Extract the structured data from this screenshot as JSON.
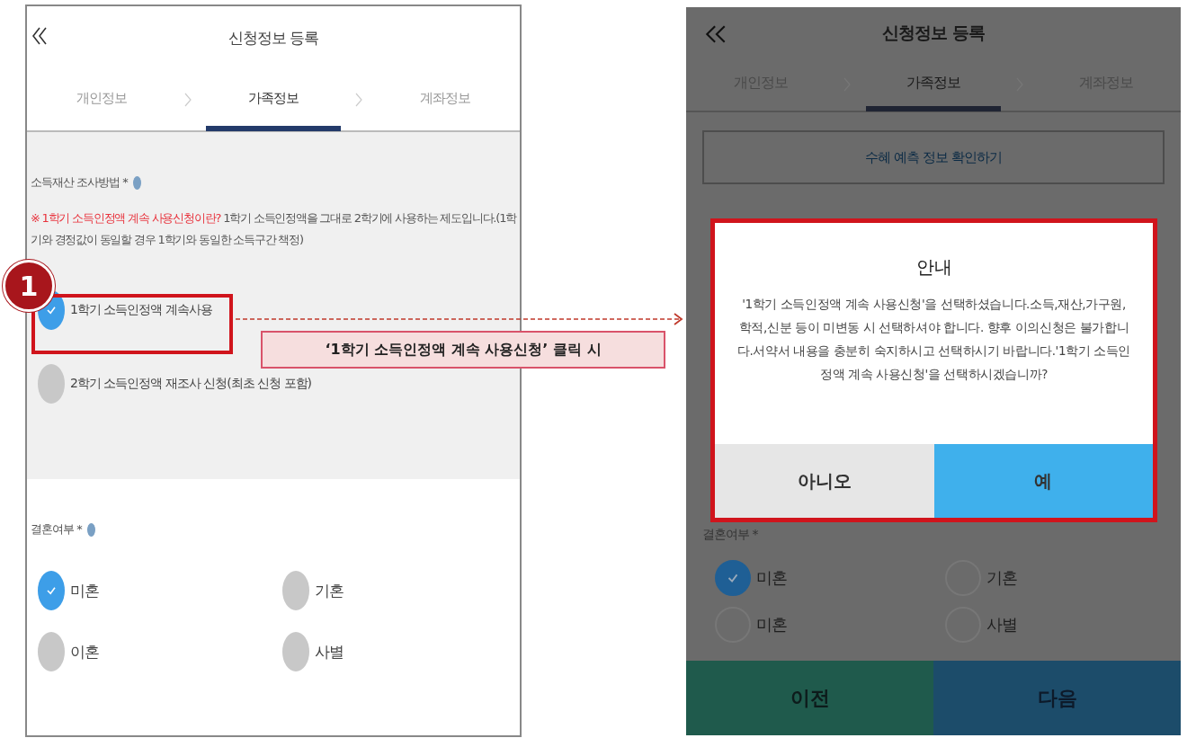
{
  "left_screen": {
    "title": "신청정보 등록",
    "tabs": [
      {
        "label": "개인정보",
        "selected": false
      },
      {
        "label": "가족정보",
        "selected": true
      },
      {
        "label": "계좌정보",
        "selected": false
      }
    ],
    "income_section": {
      "label": "소득재산 조사방법 *",
      "notice_highlight": "※ 1학기 소득인정액 계속 사용신청이란?",
      "notice_text": "1학기 소득인정액을 그대로 2학기에 사용하는 제도입니다.(1학기와 경정값이 동일할 경우 1학기와 동일한 소득구간 책정)",
      "options": [
        {
          "label": "1학기 소득인정액 계속사용",
          "checked": true
        },
        {
          "label": "2학기 소득인정액 재조사 신청(최초 신청 포함)",
          "checked": false
        }
      ]
    },
    "marital_section": {
      "label": "결혼여부 *",
      "options": [
        {
          "label": "미혼",
          "checked": true
        },
        {
          "label": "기혼",
          "checked": false
        },
        {
          "label": "이혼",
          "checked": false
        },
        {
          "label": "사별",
          "checked": false
        }
      ]
    }
  },
  "annotation": {
    "step": "1",
    "callout": "‘1학기 소득인정액 계속 사용신청’ 클릭 시"
  },
  "right_screen": {
    "title": "신청정보 등록",
    "tabs": [
      {
        "label": "개인정보",
        "selected": false
      },
      {
        "label": "가족정보",
        "selected": true
      },
      {
        "label": "계좌정보",
        "selected": false
      }
    ],
    "info_button": "수혜 예측 정보 확인하기",
    "marital_section": {
      "label": "결혼여부 *",
      "options": [
        {
          "label": "미혼",
          "checked": true
        },
        {
          "label": "기혼",
          "checked": false
        },
        {
          "label": "미혼",
          "checked": false
        },
        {
          "label": "사별",
          "checked": false
        }
      ]
    },
    "buttons": [
      {
        "label": "이전",
        "kind": "prev"
      },
      {
        "label": "다음",
        "kind": "next"
      }
    ],
    "dialog": {
      "title": "안내",
      "message": "'1학기 소득인정액 계속 사용신청'을 선택하셨습니다.소득,재산,가구원,학적,신분 등이 미변동 시 선택하셔야 합니다. 향후 이의신청은 불가합니다.서약서 내용을 충분히 숙지하시고 선택하시기 바랍니다.'1학기 소득인정액 계속 사용신청'을 선택하시겠습니까?",
      "buttons": [
        {
          "label": "아니오",
          "kind": "secondary"
        },
        {
          "label": "예",
          "kind": "primary"
        }
      ]
    }
  }
}
